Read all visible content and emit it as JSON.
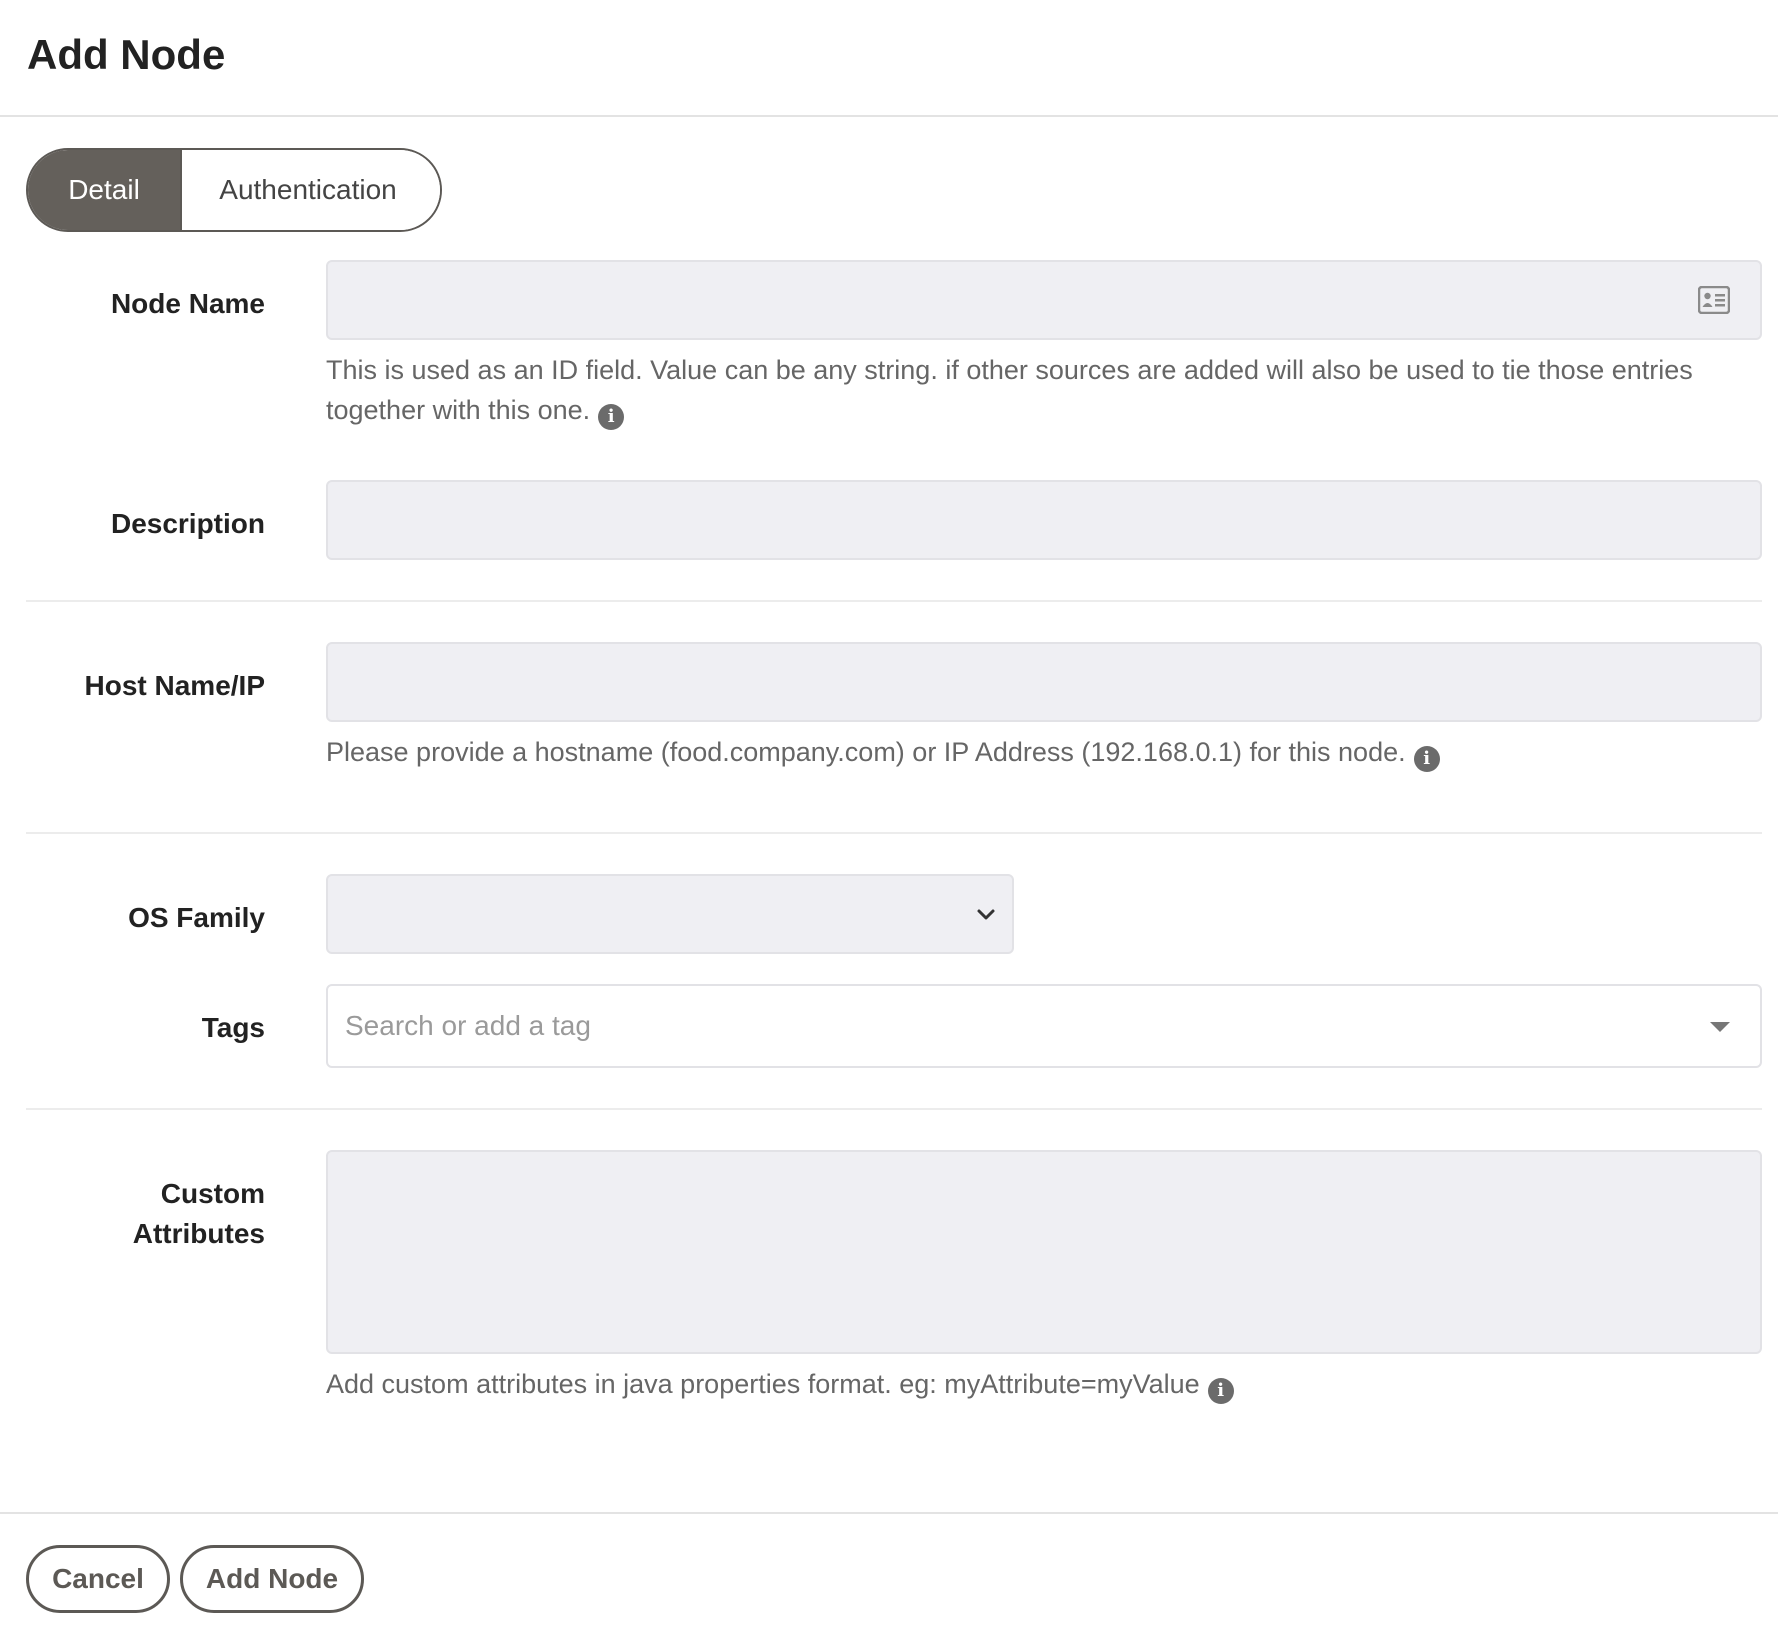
{
  "header": {
    "title": "Add Node"
  },
  "tabs": [
    {
      "label": "Detail",
      "active": true
    },
    {
      "label": "Authentication",
      "active": false
    }
  ],
  "form": {
    "node_name": {
      "label": "Node Name",
      "value": "",
      "icon": "id-card-icon",
      "help": "This is used as an ID field. Value can be any string. if other sources are added will also be used to tie those entries together with this one."
    },
    "description": {
      "label": "Description",
      "value": ""
    },
    "host_name": {
      "label": "Host Name/IP",
      "value": "",
      "help": "Please provide a hostname (food.company.com) or IP Address (192.168.0.1) for this node."
    },
    "os_family": {
      "label": "OS Family",
      "selected": ""
    },
    "tags": {
      "label": "Tags",
      "placeholder": "Search or add a tag"
    },
    "custom_attributes": {
      "label_line1": "Custom",
      "label_line2": "Attributes",
      "value": "",
      "help": "Add custom attributes in java properties format. eg: myAttribute=myValue"
    }
  },
  "footer": {
    "cancel_label": "Cancel",
    "submit_label": "Add Node"
  },
  "colors": {
    "tab_active_bg": "#64605b",
    "input_bg": "#efeff3",
    "help_text": "#666666"
  }
}
